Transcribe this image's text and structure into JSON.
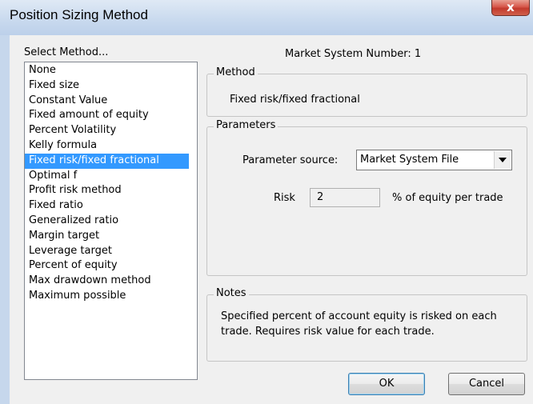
{
  "window": {
    "title": "Position Sizing Method",
    "close_glyph": "x"
  },
  "method_list": {
    "label": "Select Method...",
    "selected_index": 6,
    "items": [
      "None",
      "Fixed size",
      "Constant Value",
      "Fixed amount of equity",
      "Percent Volatility",
      "Kelly formula",
      "Fixed risk/fixed fractional",
      "Optimal f",
      "Profit risk method",
      "Fixed ratio",
      "Generalized ratio",
      "Margin target",
      "Leverage target",
      "Percent of equity",
      "Max drawdown method",
      "Maximum possible"
    ]
  },
  "market_system": {
    "label": "Market System Number:",
    "value": "1",
    "text": "Market System Number:  1"
  },
  "method_group": {
    "title": "Method",
    "value": "Fixed risk/fixed fractional"
  },
  "parameters_group": {
    "title": "Parameters",
    "source_label": "Parameter source:",
    "source_value": "Market System File",
    "risk_label": "Risk",
    "risk_value": "2",
    "risk_suffix": "% of equity per trade"
  },
  "notes_group": {
    "title": "Notes",
    "text": "Specified percent of account equity is risked on each trade. Requires risk value for each trade."
  },
  "buttons": {
    "ok": "OK",
    "cancel": "Cancel"
  },
  "colors": {
    "selection": "#3399ff",
    "dialog_bg": "#f0f0f0",
    "close_button": "#c23a2d"
  }
}
